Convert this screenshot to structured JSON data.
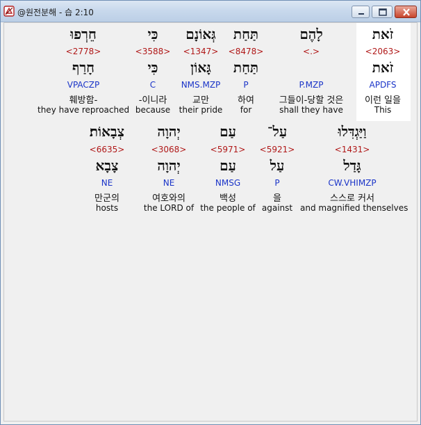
{
  "window": {
    "title": "@원전분해 - 습 2:10",
    "icon": "app-icon",
    "controls": [
      "minimize-icon",
      "maximize-icon",
      "close-icon"
    ]
  },
  "rows": [
    [
      {
        "heb1": "זֹאת",
        "strong": "<2063>",
        "heb2": "זֹאת",
        "morph": "APDFS",
        "kor": "이런 일을",
        "eng": "This"
      },
      {
        "heb1": "לָהֶם",
        "strong": "<.>",
        "heb2": "",
        "morph": "P.MZP",
        "kor": "그들이-당할 것은",
        "eng": "shall they have"
      },
      {
        "heb1": "תַּחַת",
        "strong": "<8478>",
        "heb2": "תַּחַת",
        "morph": "P",
        "kor": "하여",
        "eng": "for"
      },
      {
        "heb1": "גְּאוֹנָם",
        "strong": "<1347>",
        "heb2": "גָּאוֹן",
        "morph": "NMS.MZP",
        "kor": "교만",
        "eng": "their pride"
      },
      {
        "heb1": "כִּי",
        "strong": "<3588>",
        "heb2": "כִּי",
        "morph": "C",
        "kor": "-이니라",
        "eng": "because"
      },
      {
        "heb1": "חֵרְפוּ",
        "strong": "<2778>",
        "heb2": "חָרַף",
        "morph": "VPACZP",
        "kor": "훼방함-",
        "eng": "they have reproached"
      }
    ],
    [
      {
        "heb1": "וַיַּגְדִּלוּ",
        "strong": "<1431>",
        "heb2": "גָּדַל",
        "morph": "CW.VHIMZP",
        "kor": "스스로 커서",
        "eng": "and magnified thenselves"
      },
      {
        "heb1": "עַל־",
        "strong": "<5921>",
        "heb2": "עַל",
        "morph": "P",
        "kor": "을",
        "eng": "against"
      },
      {
        "heb1": "עַם",
        "strong": "<5971>",
        "heb2": "עַם",
        "morph": "NMSG",
        "kor": "백성",
        "eng": "the people of"
      },
      {
        "heb1": "יְהוָה",
        "strong": "<3068>",
        "heb2": "יְהוָה",
        "morph": "NE",
        "kor": "여호와의",
        "eng": "the LORD of"
      },
      {
        "heb1": "צְבָאוֹת׃",
        "strong": "<6635>",
        "heb2": "צָבָא",
        "morph": "NE",
        "kor": "만군의",
        "eng": "hosts"
      }
    ]
  ]
}
